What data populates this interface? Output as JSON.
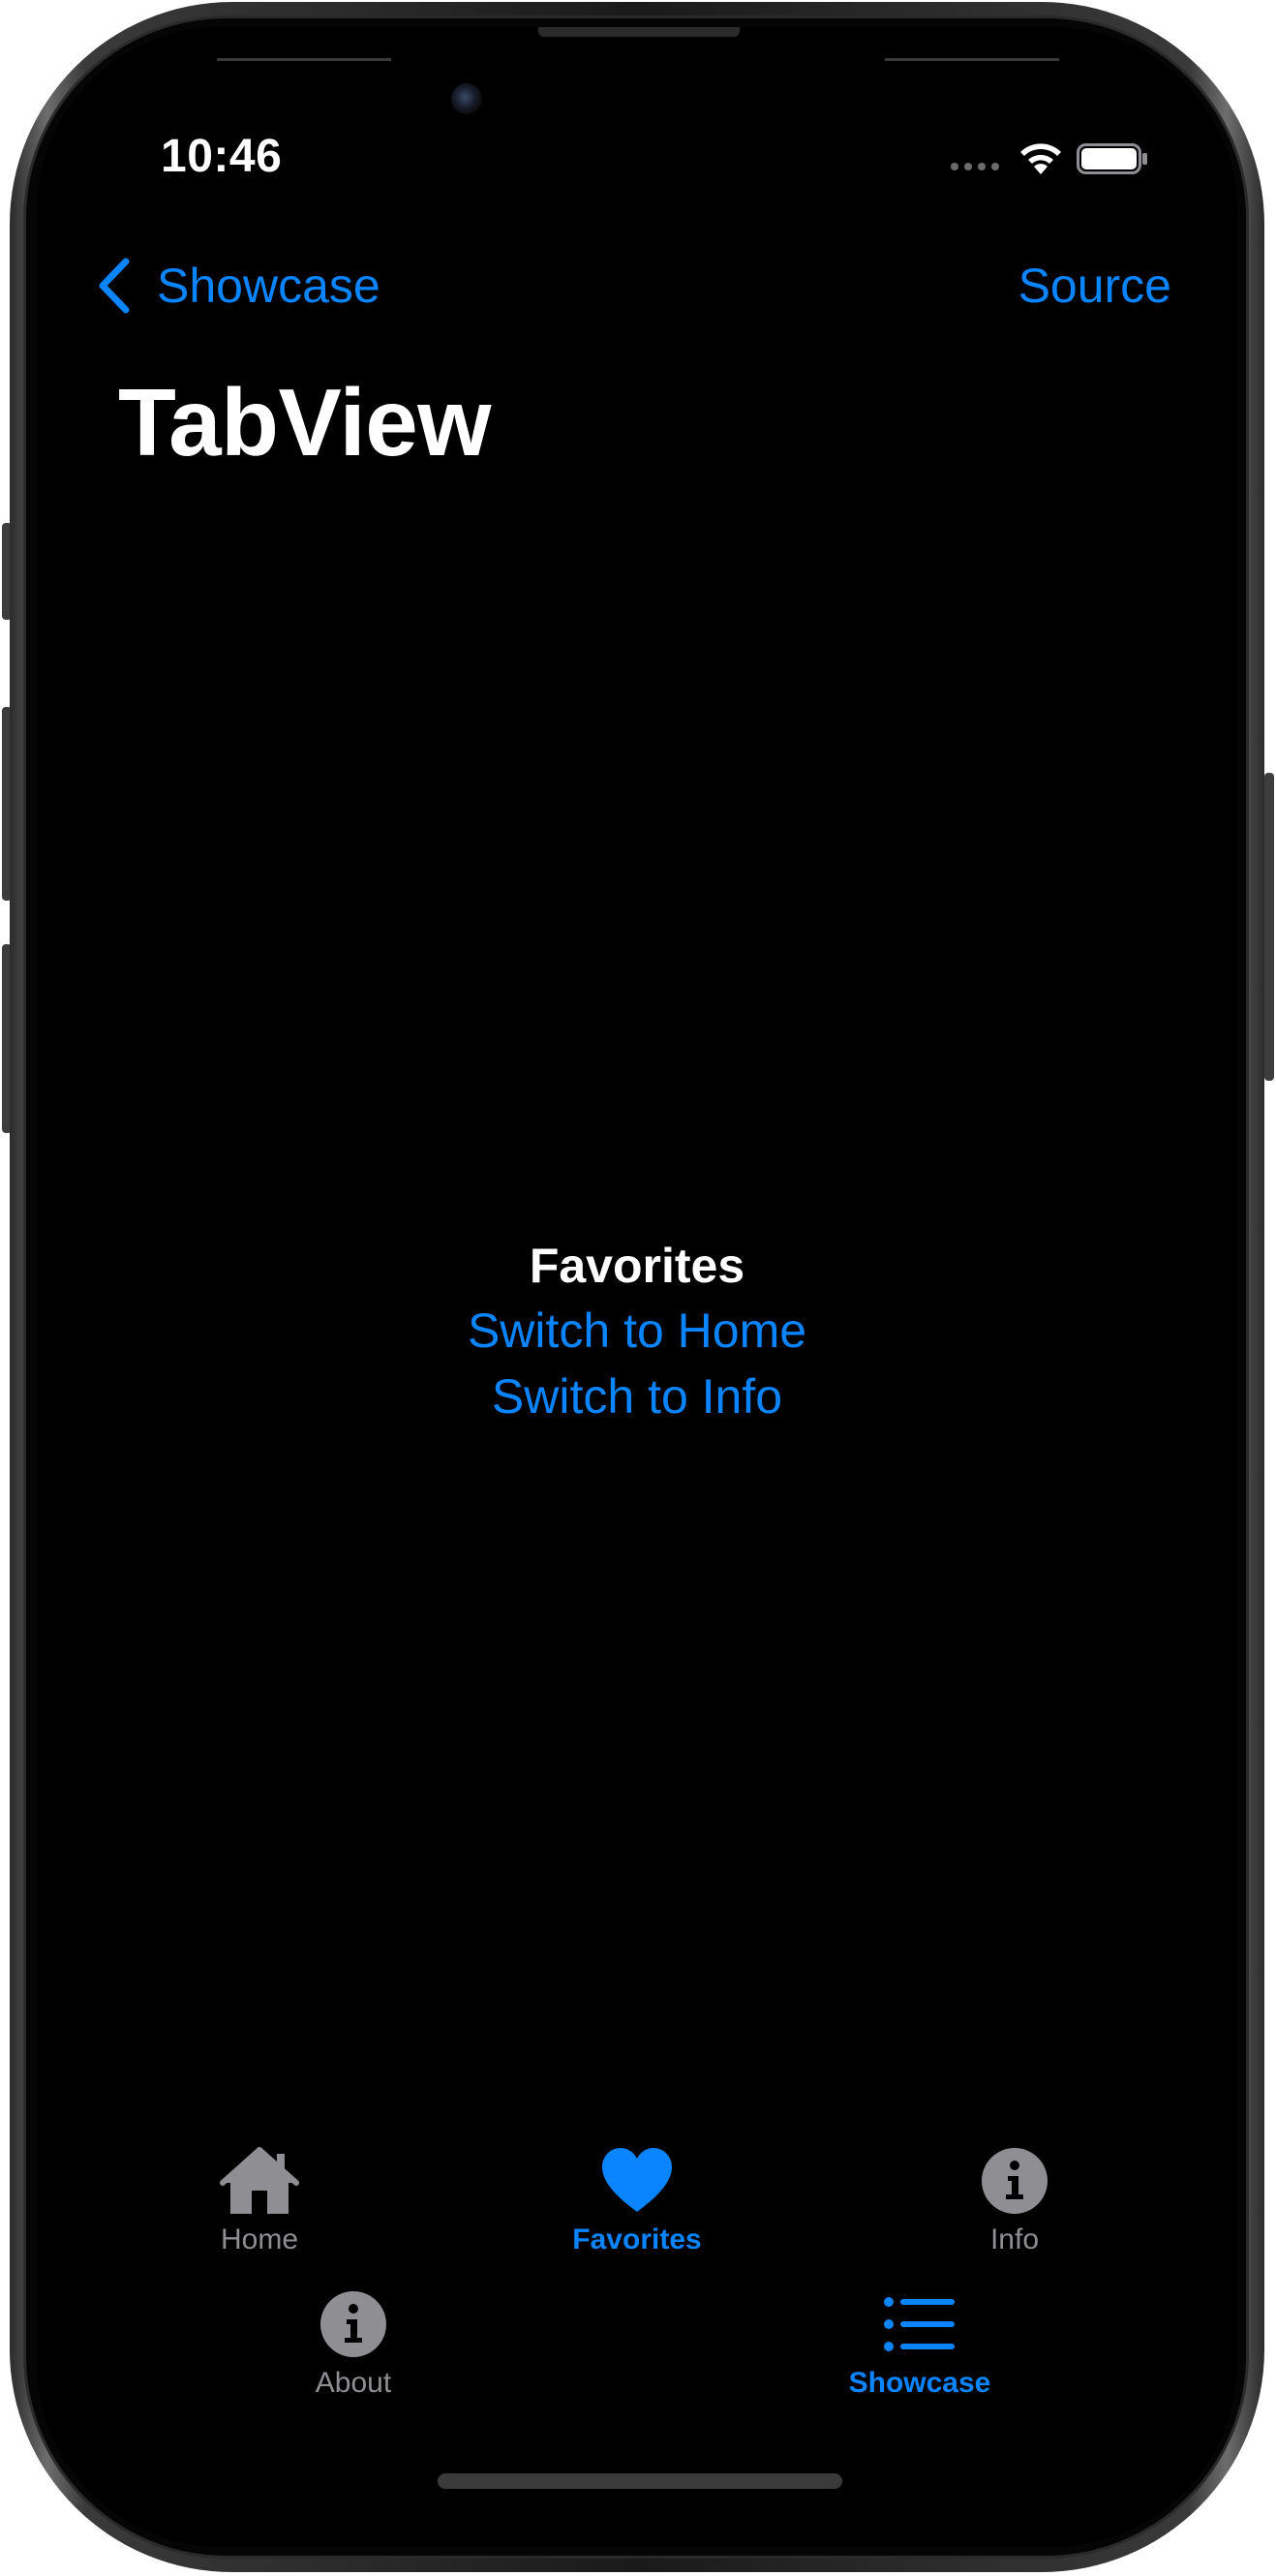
{
  "status_bar": {
    "time": "10:46"
  },
  "nav_bar": {
    "back_label": "Showcase",
    "trailing_label": "Source"
  },
  "page": {
    "title": "TabView"
  },
  "content": {
    "heading": "Favorites",
    "links": [
      "Switch to Home",
      "Switch to Info"
    ]
  },
  "tab_bar": {
    "items": [
      {
        "label": "Home",
        "icon": "house-icon",
        "active": false
      },
      {
        "label": "Favorites",
        "icon": "heart-icon",
        "active": true
      },
      {
        "label": "Info",
        "icon": "info-circle-icon",
        "active": false
      },
      {
        "label": "About",
        "icon": "info-circle-icon",
        "active": false
      },
      {
        "label": "Showcase",
        "icon": "list-icon",
        "active": true
      }
    ]
  },
  "colors": {
    "accent": "#0a84ff",
    "background": "#000000",
    "inactive": "#8e8e93"
  }
}
